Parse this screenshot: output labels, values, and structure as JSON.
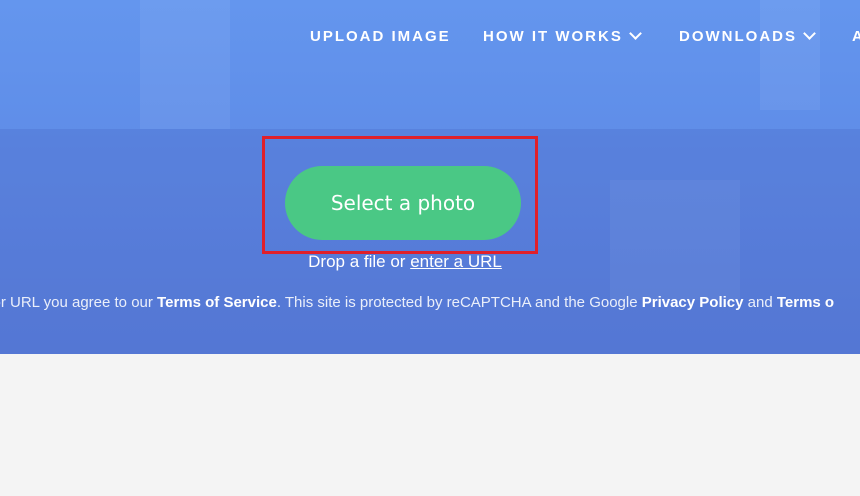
{
  "nav": {
    "items": [
      {
        "label": "UPLOAD IMAGE",
        "dropdown": false
      },
      {
        "label": "HOW IT WORKS",
        "dropdown": true
      },
      {
        "label": "DOWNLOADS",
        "dropdown": true
      },
      {
        "label": "A",
        "dropdown": false
      }
    ]
  },
  "upload": {
    "button_label": "Select a photo",
    "drop_prefix": "Drop a file or",
    "drop_link": "enter a URL"
  },
  "terms": {
    "part1": "e or URL you agree to our",
    "terms_link": "Terms of Service",
    "part2": ". This site is protected by reCAPTCHA and the Google",
    "privacy_link": "Privacy Policy",
    "part3": "and",
    "terms_link2": "Terms o"
  },
  "colors": {
    "hero": "#6496ee",
    "button": "#4ac885",
    "highlight": "#e0202a",
    "page_bg": "#f4f4f4"
  }
}
